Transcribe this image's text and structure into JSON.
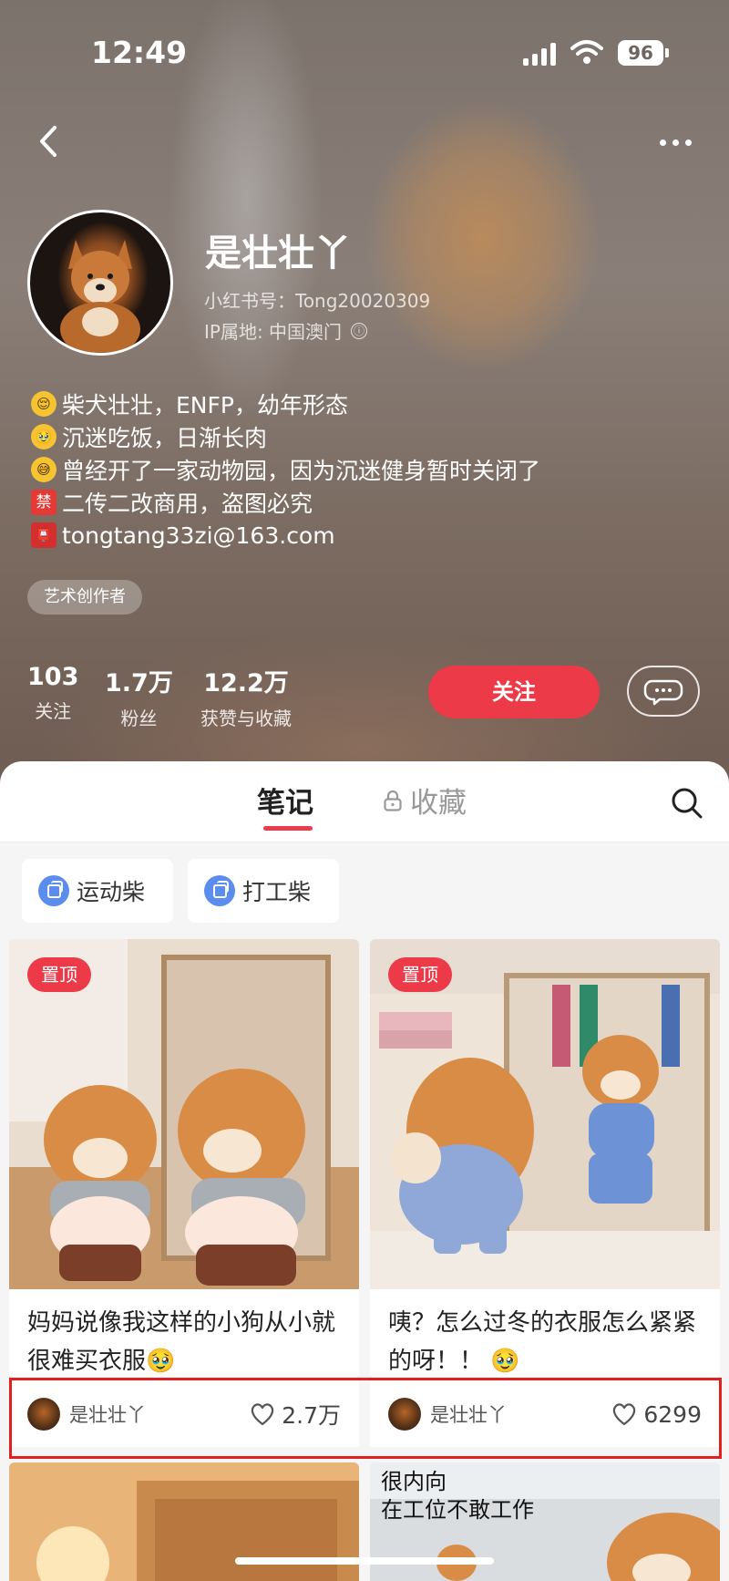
{
  "status_bar": {
    "time": "12:49",
    "battery": "96"
  },
  "profile": {
    "nickname": "是壮壮丫",
    "red_id": "小红书号：Tong20020309",
    "ip_location": "IP属地: 中国澳门",
    "info_icon": "ⓘ",
    "bio": [
      {
        "icon": "😌",
        "text": "柴犬壮壮，ENFP，幼年形态"
      },
      {
        "icon": "🥹",
        "text": "沉迷吃饭，日渐长肉"
      },
      {
        "icon": "😅",
        "text": "曾经开了一家动物园，因为沉迷健身暂时关闭了"
      },
      {
        "icon": "禁",
        "text": "二传二改商用，盗图必究"
      },
      {
        "icon": "📮",
        "text": "tongtang33zi@163.com"
      }
    ],
    "tag": "艺术创作者",
    "stats": [
      {
        "value": "103",
        "label": "关注"
      },
      {
        "value": "1.7万",
        "label": "粉丝"
      },
      {
        "value": "12.2万",
        "label": "获赞与收藏"
      }
    ],
    "follow_label": "关注"
  },
  "tabs": {
    "notes": "笔记",
    "favorites": "收藏"
  },
  "collections": [
    "运动柴",
    "打工柴"
  ],
  "notes": [
    {
      "pin": "置顶",
      "title": "妈妈说像我这样的小狗从小就很难买衣服🥹",
      "author": "是壮壮丫",
      "likes": "2.7万"
    },
    {
      "pin": "置顶",
      "title": "咦？怎么过冬的衣服怎么紧紧的呀！！ 🥹",
      "author": "是壮壮丫",
      "likes": "6299"
    }
  ],
  "next_notes": [
    {
      "caption_line1": "",
      "caption_line2": ""
    },
    {
      "caption_line1": "很内向",
      "caption_line2": "在工位不敢工作"
    }
  ],
  "colors": {
    "accent": "#ec3a48",
    "highlight": "#e02020",
    "collection_icon": "#5b8def"
  }
}
